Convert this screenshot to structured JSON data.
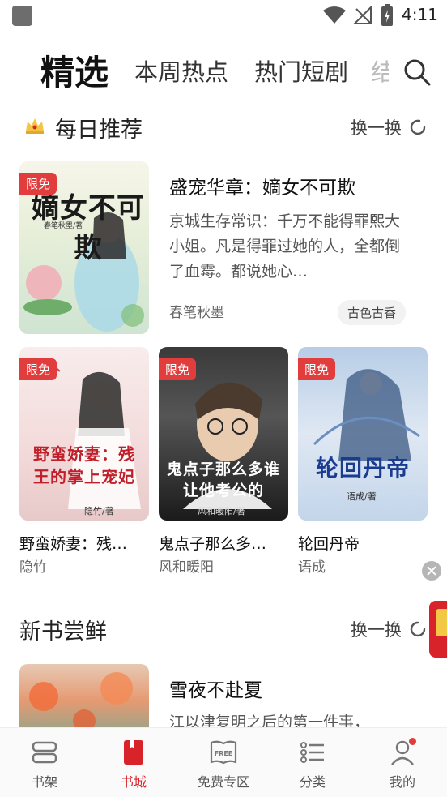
{
  "status_bar": {
    "time": "4:11",
    "icons": [
      "app-icon",
      "wifi-icon",
      "no-signal-icon",
      "battery-charging-icon"
    ]
  },
  "top_tabs": {
    "items": [
      {
        "label": "精选",
        "active": true
      },
      {
        "label": "本周热点",
        "active": false
      },
      {
        "label": "热门短剧",
        "active": false
      },
      {
        "label": "结",
        "active": false
      }
    ],
    "search_icon": "search-icon"
  },
  "daily": {
    "title": "每日推荐",
    "refresh_label": "换一换",
    "featured": {
      "free_tag": "限免",
      "cover_title": "嫡女不可欺",
      "cover_author": "春笔秋墨/著",
      "title": "盛宠华章：嫡女不可欺",
      "description": "京城生存常识：千万不能得罪熙大小姐。凡是得罪过她的人，全都倒了血霉。都说她心…",
      "author": "春笔秋墨",
      "tag": "古色古香"
    },
    "grid": [
      {
        "free_tag": "限免",
        "cover_title": "野蛮娇妻：残王的掌上宠妃",
        "cover_author": "隐竹/著",
        "title": "野蛮娇妻：残王的掌上宠妃",
        "author": "隐竹"
      },
      {
        "free_tag": "限免",
        "cover_title": "鬼点子那么多谁让他考公的",
        "cover_author": "风和暖阳/著",
        "title": "鬼点子那么多谁让他考公的",
        "author": "风和暖阳"
      },
      {
        "free_tag": "限免",
        "cover_title": "轮回丹帝",
        "cover_author": "语成/著",
        "title": "轮回丹帝",
        "author": "语成"
      }
    ]
  },
  "new_books": {
    "title": "新书尝鲜",
    "refresh_label": "换一换",
    "first": {
      "title": "雪夜不赴夏",
      "description": "江以津复明之后的第一件事，"
    }
  },
  "bottom_nav": {
    "items": [
      {
        "label": "书架",
        "icon": "bookshelf-icon",
        "active": false
      },
      {
        "label": "书城",
        "icon": "bookstore-icon",
        "active": true
      },
      {
        "label": "免费专区",
        "icon": "free-book-icon",
        "active": false,
        "icon_text": "FREE"
      },
      {
        "label": "分类",
        "icon": "category-icon",
        "active": false
      },
      {
        "label": "我的",
        "icon": "profile-icon",
        "active": false
      }
    ]
  },
  "colors": {
    "accent": "#d8232a",
    "tag_red": "#e23d3d"
  }
}
